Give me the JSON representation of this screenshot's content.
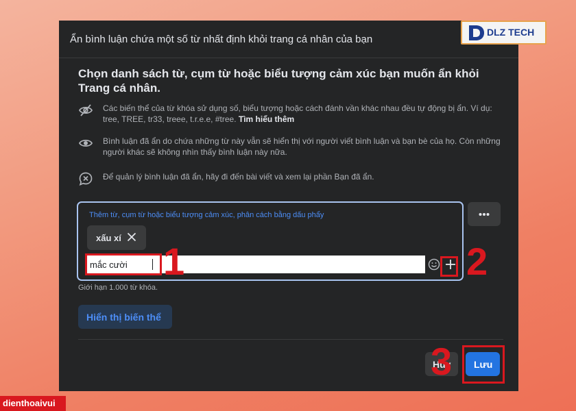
{
  "dialog": {
    "title": "Ẩn bình luận chứa một số từ nhất định khỏi trang cá nhân của bạn",
    "heading": "Chọn danh sách từ, cụm từ hoặc biểu tượng cảm xúc bạn muốn ẩn khỏi Trang cá nhân.",
    "info": [
      {
        "icon": "eye-slash-icon",
        "text": "Các biến thể của từ khóa sử dụng số, biểu tượng hoặc cách đánh vần khác nhau đều tự động bị ẩn. Ví dụ: tree, TREE, tr33, treee, t.r.e.e, #tree.",
        "link": "Tìm hiểu thêm"
      },
      {
        "icon": "eye-icon",
        "text": "Bình luận đã ẩn do chứa những từ này vẫn sẽ hiển thị với người viết bình luận và bạn bè của họ. Còn những người khác sẽ không nhìn thấy bình luận này nữa."
      },
      {
        "icon": "chat-x-icon",
        "text": "Để quản lý bình luận đã ẩn, hãy đi đến bài viết và xem lại phần Bạn đã ẩn."
      }
    ],
    "keyword_box": {
      "label": "Thêm từ, cụm từ hoặc biểu tượng cảm xúc, phân cách bằng dấu phẩy",
      "chips": [
        "xấu xí"
      ],
      "input_value": "mắc cười",
      "input_placeholder": ""
    },
    "limit_text": "Giới hạn 1.000 từ khóa.",
    "show_variants_label": "Hiển thị biến thể",
    "cancel_label": "Hủy",
    "save_label": "Lưu"
  },
  "annotations": {
    "step1": "1",
    "step2": "2",
    "step3": "3",
    "color": "#d9181f"
  },
  "branding": {
    "logo_text": "DLZ TECH",
    "watermark": "dienthoaivui"
  },
  "colors": {
    "dialog_bg": "#242526",
    "accent_blue": "#2374e1",
    "link_blue": "#4d8ef7",
    "highlight_red": "#d9181f"
  }
}
